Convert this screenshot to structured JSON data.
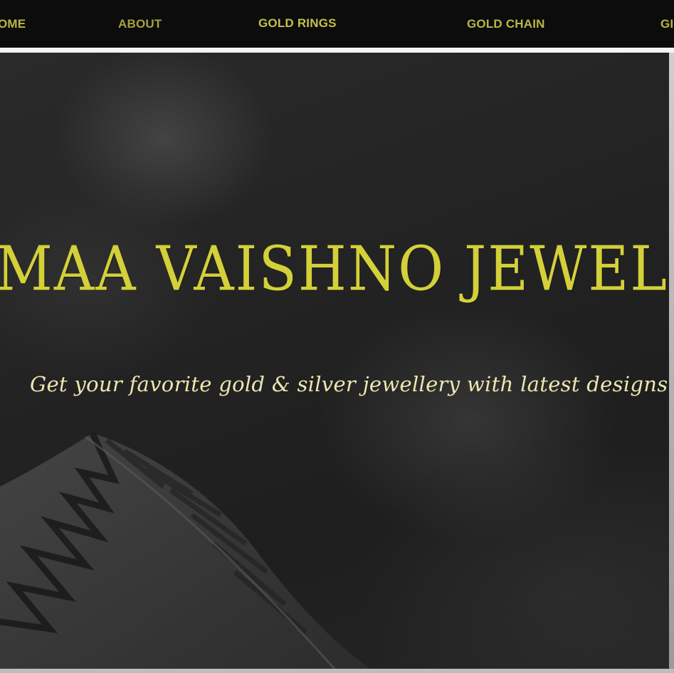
{
  "nav": {
    "items": [
      {
        "label": "HOME",
        "display": "OME"
      },
      {
        "label": "ABOUT"
      },
      {
        "label": "GOLD RINGS"
      },
      {
        "label": "GOLD CHAIN"
      },
      {
        "label": "GI"
      }
    ],
    "colors": {
      "text": "#b9b746",
      "bar": "#0c0c0c",
      "rule": "#f4f4f4"
    }
  },
  "hero": {
    "title": "MAA VAISHNO JEWELLERS",
    "subtitle": "Get your favorite gold & silver jewellery with latest designs options",
    "colors": {
      "title": "#d3d039",
      "subtitle": "#ece7b0",
      "background": "#232323"
    },
    "background_image": "feather-on-dark-texture"
  }
}
